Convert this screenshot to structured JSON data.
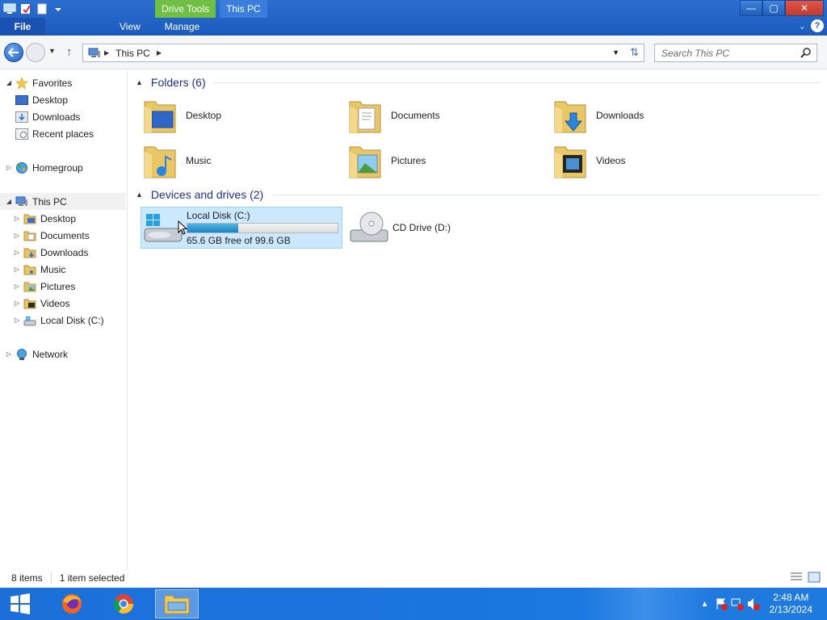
{
  "window": {
    "title": "This PC",
    "context_tab_group": "Drive Tools",
    "ribbon_tabs": [
      "File",
      "View",
      "Manage"
    ],
    "controls": {
      "minimize": "—",
      "maximize": "▢",
      "close": "✕"
    }
  },
  "address_bar": {
    "location": "This PC",
    "search_placeholder": "Search This PC"
  },
  "nav_pane": {
    "favorites": {
      "label": "Favorites",
      "items": [
        "Desktop",
        "Downloads",
        "Recent places"
      ]
    },
    "homegroup": {
      "label": "Homegroup"
    },
    "this_pc": {
      "label": "This PC",
      "items": [
        "Desktop",
        "Documents",
        "Downloads",
        "Music",
        "Pictures",
        "Videos",
        "Local Disk (C:)"
      ]
    },
    "network": {
      "label": "Network"
    }
  },
  "content": {
    "folders_header": "Folders (6)",
    "folders": [
      "Desktop",
      "Documents",
      "Downloads",
      "Music",
      "Pictures",
      "Videos"
    ],
    "drives_header": "Devices and drives (2)",
    "drives": [
      {
        "name": "Local Disk (C:)",
        "free_text": "65.6 GB free of 99.6 GB",
        "used_fraction": 0.34,
        "selected": true
      },
      {
        "name": "CD Drive (D:)"
      }
    ]
  },
  "status_bar": {
    "item_count": "8 items",
    "selection": "1 item selected"
  },
  "taskbar": {
    "apps": [
      "start-icon",
      "firefox-icon",
      "chrome-icon",
      "file-explorer-icon"
    ],
    "clock_time": "2:48 AM",
    "clock_date": "2/13/2024"
  },
  "colors": {
    "titlebar": "#1c5bbd",
    "drive_tools": "#6fbf45",
    "selection": "#cce8ff",
    "taskbar": "#1f7ae0"
  }
}
